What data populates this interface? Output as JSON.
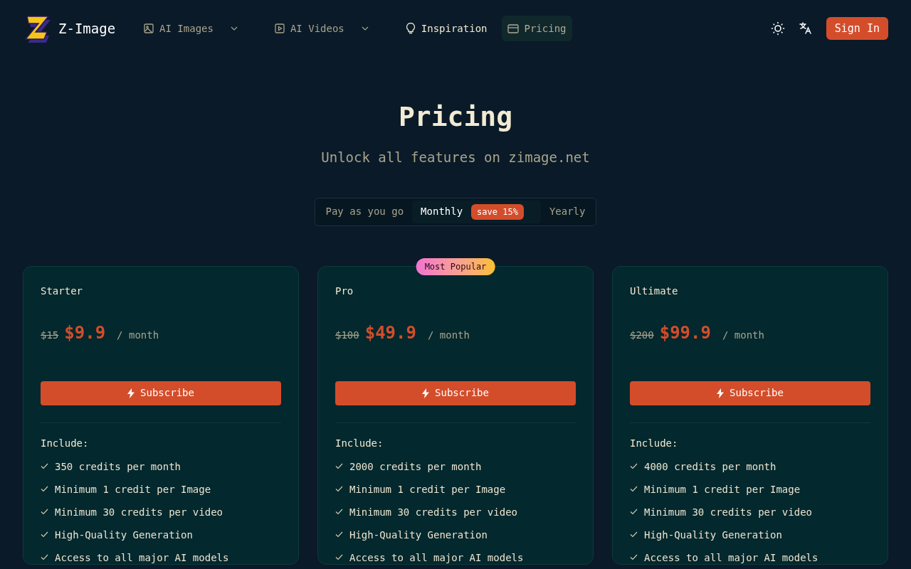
{
  "header": {
    "logo_text": "Z-Image",
    "nav": [
      {
        "label": "AI Images",
        "dropdown": true,
        "selected": false
      },
      {
        "label": "AI Videos",
        "dropdown": true,
        "selected": false
      },
      {
        "label": "Inspiration",
        "dropdown": false,
        "selected": false
      },
      {
        "label": "Pricing",
        "dropdown": false,
        "selected": true
      }
    ],
    "sign_in": "Sign In"
  },
  "title": "Pricing",
  "subtitle": "Unlock all features on zimage.net",
  "billing_tabs": [
    {
      "label": "Pay as you go",
      "selected": false
    },
    {
      "label": "Monthly",
      "badge": "save 15%",
      "selected": true
    },
    {
      "label": "Yearly",
      "selected": false
    }
  ],
  "plans": [
    {
      "name": "Starter",
      "old_price": "$15",
      "price": "$9.9",
      "period": "/ month",
      "button": "Subscribe",
      "include_label": "Include:",
      "features": [
        "350 credits per month",
        "Minimum 1 credit per Image",
        "Minimum 30 credits per video",
        "High-Quality Generation",
        "Access to all major AI models"
      ]
    },
    {
      "name": "Pro",
      "badge": "Most Popular",
      "old_price": "$100",
      "price": "$49.9",
      "period": "/ month",
      "button": "Subscribe",
      "include_label": "Include:",
      "features": [
        "2000 credits per month",
        "Minimum 1 credit per Image",
        "Minimum 30 credits per video",
        "High-Quality Generation",
        "Access to all major AI models"
      ]
    },
    {
      "name": "Ultimate",
      "old_price": "$200",
      "price": "$99.9",
      "period": "/ month",
      "button": "Subscribe",
      "include_label": "Include:",
      "features": [
        "4000 credits per month",
        "Minimum 1 credit per Image",
        "Minimum 30 credits per video",
        "High-Quality Generation",
        "Access to all major AI models"
      ]
    }
  ]
}
